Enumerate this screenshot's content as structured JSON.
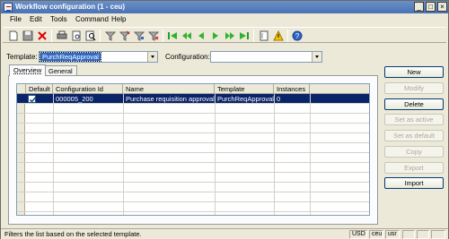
{
  "window": {
    "title": "Workflow configuration (1 - ceu)"
  },
  "menu": {
    "items": [
      "File",
      "Edit",
      "Tools",
      "Command",
      "Help"
    ]
  },
  "toolbar": {
    "icons": [
      "new-document-icon",
      "save-icon",
      "delete-icon",
      "print-icon",
      "print-preview-icon",
      "find-icon",
      "filter-icon",
      "filter-by-selection-icon",
      "advanced-filter-icon",
      "remove-filter-icon",
      "first-record-icon",
      "previous-page-icon",
      "previous-record-icon",
      "next-record-icon",
      "next-page-icon",
      "last-record-icon",
      "attachments-icon",
      "alert-icon",
      "help-icon"
    ]
  },
  "form": {
    "template_label": "Template:",
    "template_value": "PurchReqApproval",
    "configuration_label": "Configuration:",
    "configuration_value": ""
  },
  "tabs": [
    {
      "label": "Overview",
      "active": true
    },
    {
      "label": "General",
      "active": false
    }
  ],
  "grid": {
    "columns": [
      "Default",
      "Configuration Id",
      "Name",
      "Template",
      "Instances"
    ],
    "rows": [
      {
        "default": true,
        "configuration_id": "000005_200",
        "name": "Purchase requisition approval",
        "template": "PurchReqApproval",
        "instances": "0"
      }
    ]
  },
  "buttons": [
    {
      "label": "New",
      "enabled": true
    },
    {
      "label": "Modify",
      "enabled": false
    },
    {
      "label": "Delete",
      "enabled": true
    },
    {
      "label": "Set as active",
      "enabled": false
    },
    {
      "label": "Set as default",
      "enabled": false
    },
    {
      "label": "Copy",
      "enabled": false
    },
    {
      "label": "Export",
      "enabled": false
    },
    {
      "label": "Import",
      "enabled": true
    }
  ],
  "status": {
    "text": "Filters the list based on the selected template.",
    "currency": "USD",
    "company": "ceu",
    "layer": "usr"
  }
}
